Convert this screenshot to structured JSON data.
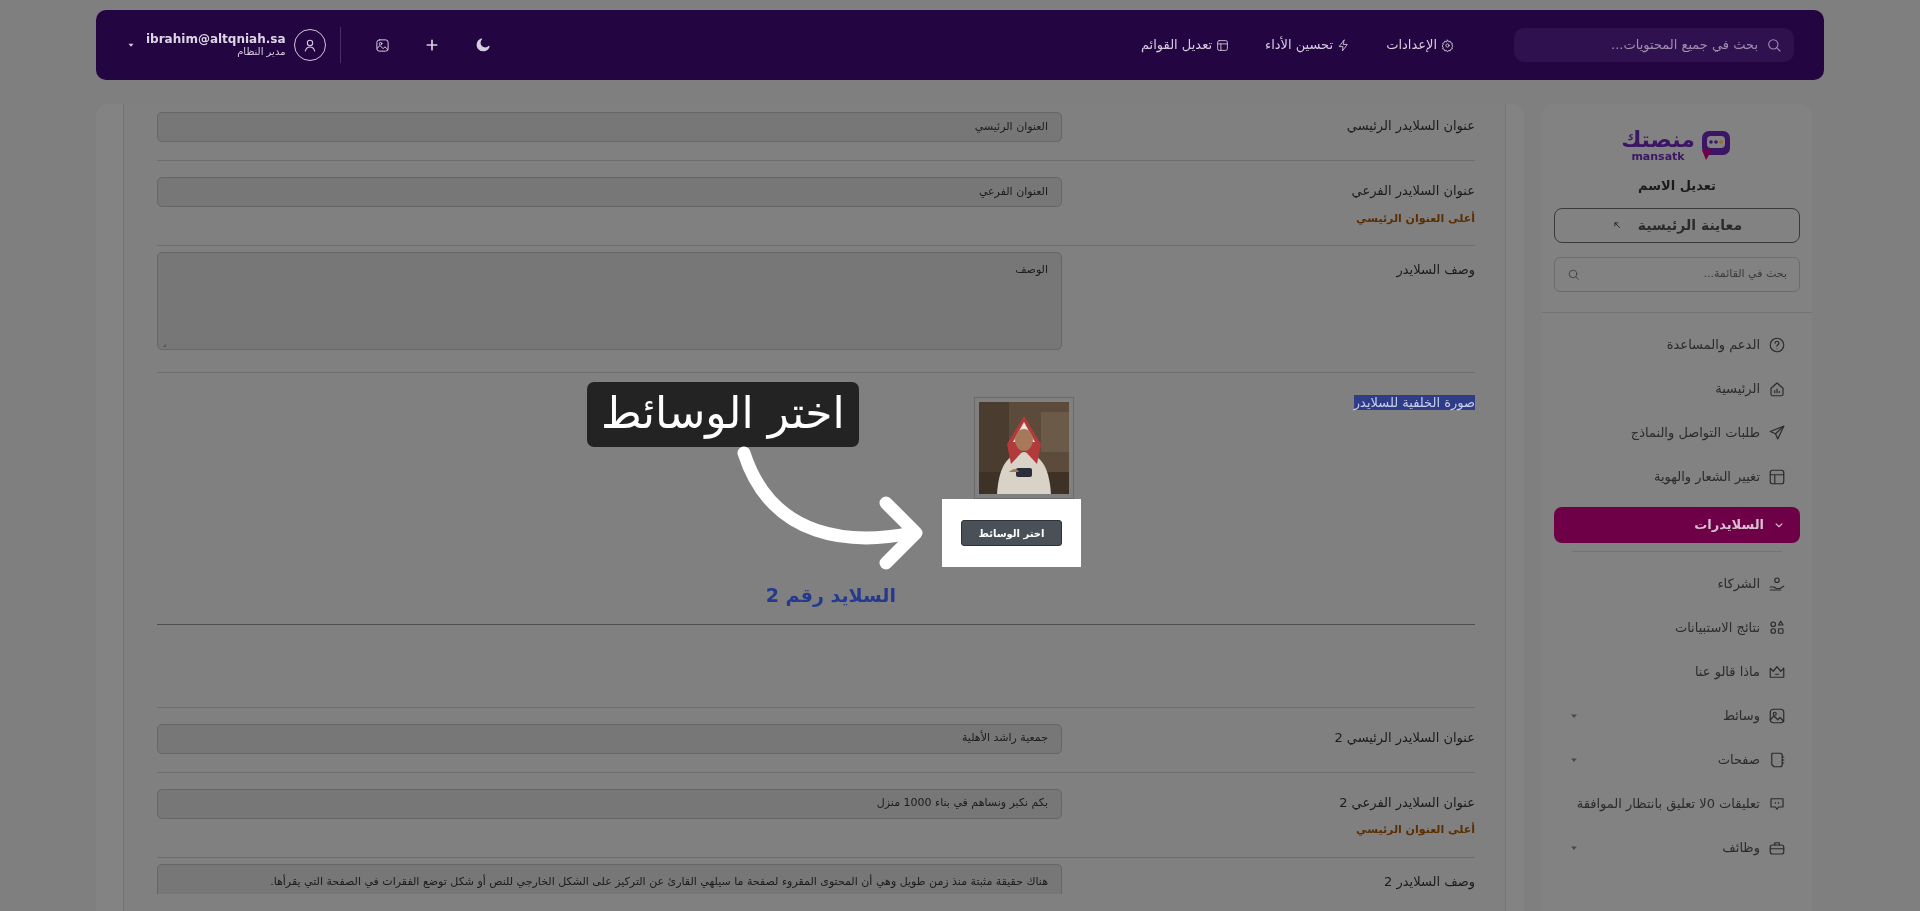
{
  "topbar": {
    "search": {
      "placeholder": "بحث في جميع المحتويات..."
    },
    "links": [
      {
        "label": "الإعدادات"
      },
      {
        "label": "تحسين الأداء"
      },
      {
        "label": "تعديل القوائم"
      }
    ],
    "user": {
      "email": "ibrahim@altqniah.sa",
      "role": "مدير النظام"
    }
  },
  "sidebar": {
    "logo": {
      "arabic": "منصتك",
      "latin": "mansatk"
    },
    "title": "تعديل الاسم",
    "preview_button": "معاينة الرئيسية",
    "search": {
      "placeholder": "بحث في القائمة..."
    },
    "items": [
      {
        "label": "الدعم والمساعدة",
        "selected": false,
        "caret": false
      },
      {
        "label": "الرئيسية",
        "selected": false,
        "caret": false
      },
      {
        "label": "طلبات التواصل والنماذج",
        "selected": false,
        "caret": false
      },
      {
        "label": "تغيير الشعار والهوية",
        "selected": false,
        "caret": false
      },
      {
        "label": "السلايدرات",
        "selected": true,
        "caret": false
      },
      {
        "label": "الشركاء",
        "selected": false,
        "caret": false
      },
      {
        "label": "نتائج الاستبيانات",
        "selected": false,
        "caret": false
      },
      {
        "label": "ماذا قالو عنا",
        "selected": false,
        "caret": false
      },
      {
        "label": "وسائط",
        "selected": false,
        "caret": true
      },
      {
        "label": "صفحات",
        "selected": false,
        "caret": true
      },
      {
        "label": "تعليقات 0لا تعليق بانتظار الموافقة",
        "selected": false,
        "caret": false
      },
      {
        "label": "وظائف",
        "selected": false,
        "caret": true
      }
    ]
  },
  "form": {
    "rows": [
      {
        "kind": "input",
        "label": "عنوان السلايدر الرئيسي",
        "value": "العنوان الرئيسي"
      },
      {
        "kind": "input",
        "label": "عنوان السلايدر الفرعي",
        "value": "العنوان الفرعي",
        "hint": "أعلى العنوان الرئيسي"
      },
      {
        "kind": "textarea",
        "label": "وصف السلايدر",
        "value": "الوصف"
      },
      {
        "kind": "media",
        "label": "صورة الخلفية للسلايدر",
        "label_highlighted": true,
        "button": "اختر الوسائط",
        "spotlight": true,
        "tour_text": "اختر الوسائط"
      },
      {
        "kind": "heading",
        "text": "السلايد رقم 2"
      },
      {
        "kind": "input",
        "label": "عنوان السلايدر الرئيسي 2",
        "value": "جمعية راشد الأهلية"
      },
      {
        "kind": "input",
        "label": "عنوان السلايدر الفرعي 2",
        "value": "بكم نكبر ونساهم في بناء 1000 منزل",
        "hint": "أعلى العنوان الرئيسي"
      },
      {
        "kind": "textarea",
        "label": "وصف السلايدر 2",
        "value": "هناك حقيقة مثبتة منذ زمن طويل وهي أن المحتوى المقروء لصفحة ما سيلهي القارئ عن التركيز على الشكل الخارجي للنص أو شكل توضع الفقرات في الصفحة التي يقرأها."
      }
    ]
  }
}
